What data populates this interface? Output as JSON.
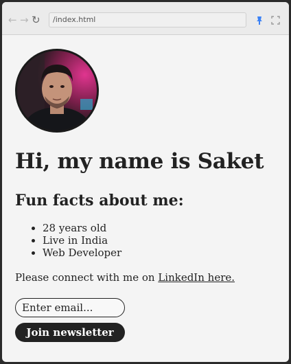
{
  "browser": {
    "url": "/index.html",
    "back_icon": "←",
    "forward_icon": "→",
    "reload_icon": "↻"
  },
  "profile": {
    "heading": "Hi, my name is Saket",
    "facts_heading": "Fun facts about me:",
    "facts": [
      "28 years old",
      "Live in India",
      "Web Developer"
    ],
    "connect_prefix": "Please connect with me on ",
    "connect_link": "LinkedIn here."
  },
  "newsletter": {
    "email_placeholder": "Enter email...",
    "button_label": "Join newsletter"
  },
  "colors": {
    "accent_pin": "#3b82f6",
    "button_bg": "#222222"
  }
}
